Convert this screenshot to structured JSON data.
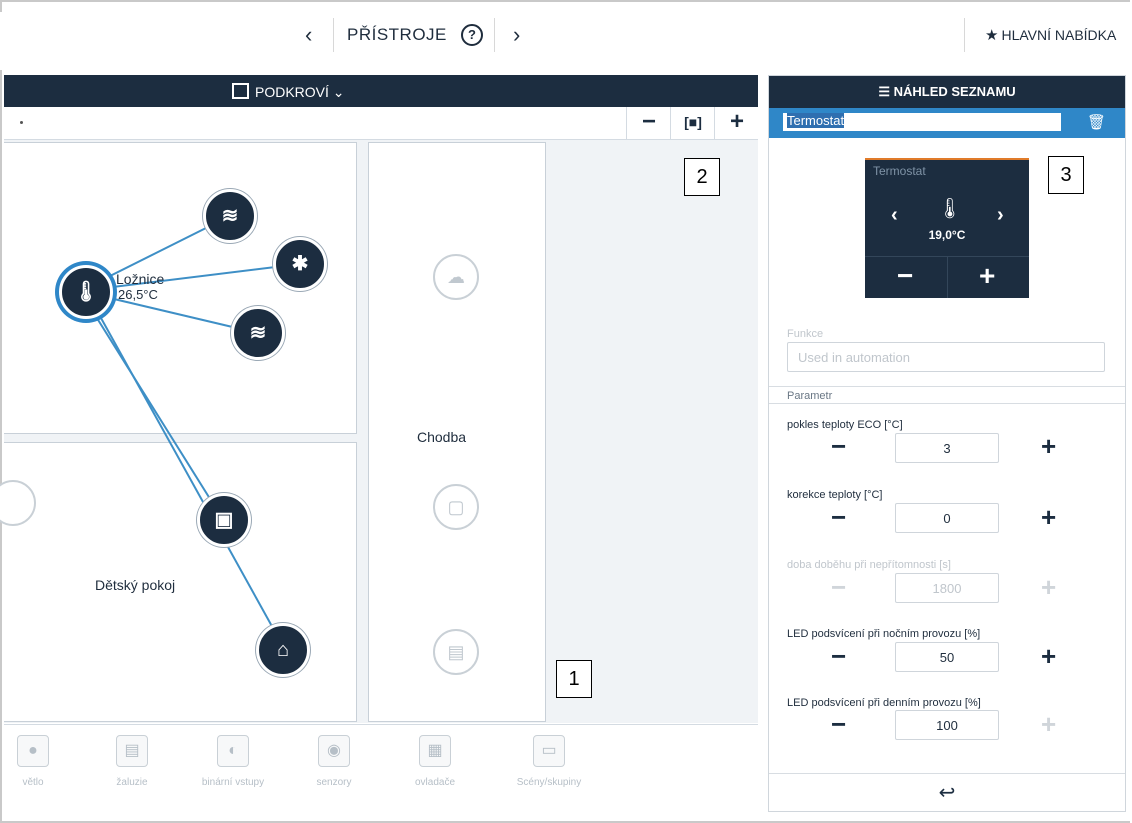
{
  "topbar": {
    "title": "PŘÍSTROJE",
    "prev_icon": "chevron-left-icon",
    "next_icon": "chevron-right-icon",
    "help_icon": "question-circle-icon",
    "main_menu_label": "HLAVNÍ NABÍDKA",
    "main_menu_icon": "star-icon"
  },
  "floor_header": {
    "label": "PODKROVÍ",
    "icon": "floorplan-icon"
  },
  "zoom": {
    "minus": "−",
    "fit_icon": "fit-screen-icon",
    "plus": "+"
  },
  "rooms": {
    "loznice": {
      "name": "Ložnice",
      "temp": "26,5°C"
    },
    "chodba": {
      "name": "Chodba"
    },
    "detsky_pokoj": {
      "name": "Dětský pokoj"
    }
  },
  "callouts": {
    "c1": "1",
    "c2": "2",
    "c3": "3"
  },
  "categories": [
    {
      "label": "větlo",
      "icon": "light-bulb-icon"
    },
    {
      "label": "žaluzie",
      "icon": "blinds-icon"
    },
    {
      "label": "binární vstupy",
      "icon": "binary-input-icon"
    },
    {
      "label": "senzory",
      "icon": "sensor-icon"
    },
    {
      "label": "ovladače",
      "icon": "controller-icon"
    },
    {
      "label": "Scény/skupiny",
      "icon": "scenes-icon"
    }
  ],
  "panel": {
    "header": "NÁHLED SEZNAMU",
    "header_icon": "list-icon",
    "name_value": "Termostat",
    "trash_icon": "trash-icon",
    "card": {
      "title": "Termostat",
      "temp": "19,0°C",
      "minus": "−",
      "plus": "+"
    },
    "function_label": "Funkce",
    "function_placeholder": "Used in automation",
    "param_header": "Parametr",
    "params": [
      {
        "label": "pokles teploty ECO [°C]",
        "value": "3"
      },
      {
        "label": "korekce teploty [°C]",
        "value": "0"
      },
      {
        "label": "doba doběhu při nepřítomnosti [s]",
        "value": "1800"
      },
      {
        "label": "LED podsvícení při nočním provozu [%]",
        "value": "50"
      },
      {
        "label": "LED podsvícení při denním provozu [%]",
        "value": "100"
      }
    ],
    "back_icon": "back-arrow-icon"
  }
}
